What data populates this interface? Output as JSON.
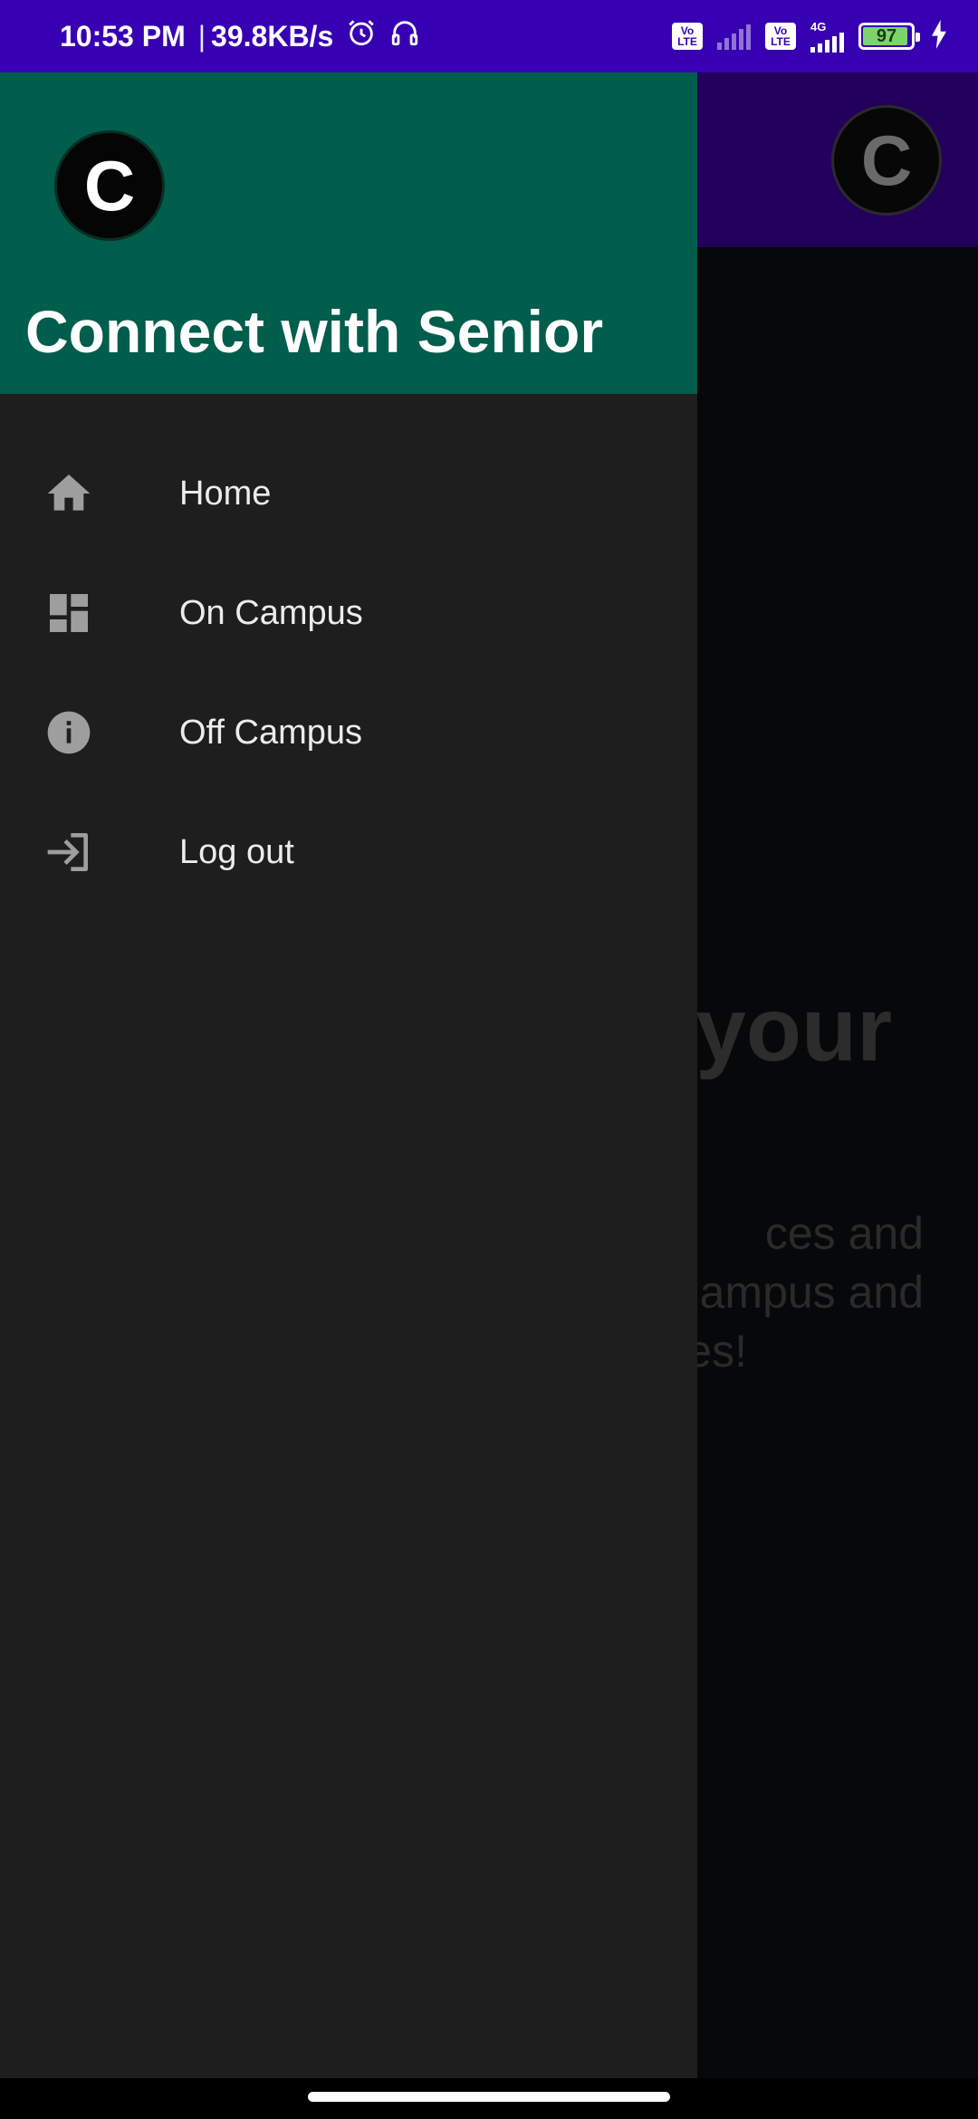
{
  "status_bar": {
    "time": "10:53 PM",
    "separator": "|",
    "net_speed": "39.8KB/s",
    "icons": [
      "alarm-icon",
      "headset-icon"
    ],
    "sim1_badge": "Vo LTE",
    "sim2_badge": "Vo LTE",
    "network_type": "4G",
    "battery_level": "97",
    "charging": true
  },
  "app_behind": {
    "logo_letter": "C",
    "heading_fragment": "your",
    "text_lines": [
      "ces and",
      "ampus and",
      "es!"
    ]
  },
  "drawer": {
    "logo_letter": "C",
    "title": "Connect with Senior",
    "header_color": "#015d4c",
    "items": [
      {
        "label": "Home",
        "icon": "home-icon"
      },
      {
        "label": "On Campus",
        "icon": "dashboard-icon"
      },
      {
        "label": "Off Campus",
        "icon": "info-icon"
      },
      {
        "label": "Log out",
        "icon": "login-icon"
      }
    ]
  },
  "colors": {
    "status_bar": "#3700b3",
    "app_toolbar": "#23005c",
    "drawer_bg": "#1e1e1f",
    "icon_gray": "#9e9e9e"
  }
}
